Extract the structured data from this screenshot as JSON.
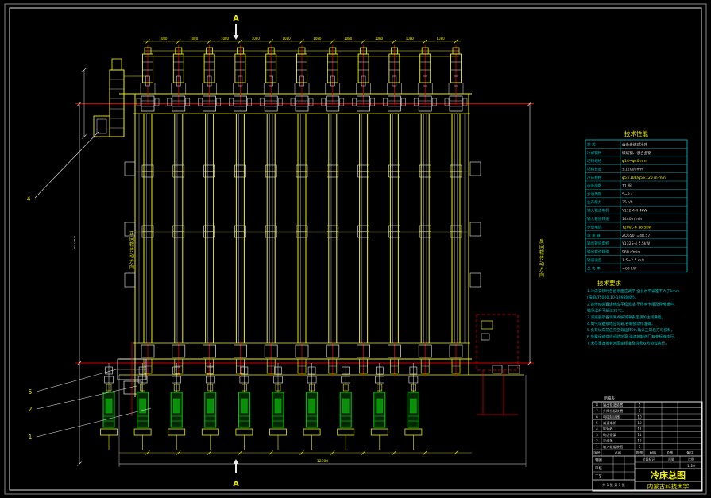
{
  "colors": {
    "yellow": "#f0f000",
    "red": "#d40000",
    "white": "#e8e8e8",
    "cyan": "#00b4b4",
    "green": "#00cc00",
    "dim_yellow": "#b8b800",
    "text_white": "#d8d8d8",
    "req_cyan": "#00c8c8"
  },
  "section_markers": {
    "top": "A",
    "bottom": "A"
  },
  "direction_labels": {
    "left": "正向辊传动方向",
    "right": "反向辊传动方向"
  },
  "callouts": [
    "4",
    "5",
    "2",
    "1"
  ],
  "dimensions": {
    "pitch": "1080",
    "total": "12300",
    "height": "4870"
  },
  "spec_table": {
    "title": "技术性能",
    "rows": [
      [
        "型 式",
        "齿条步进式冷床",
        0
      ],
      [
        "冷却钢种",
        "碳结钢、低合金钢",
        0
      ],
      [
        "坯料规格",
        "φ14~φ40mm",
        1
      ],
      [
        "坯料长度",
        "≤12000mm",
        0
      ],
      [
        "冷床规格",
        "φ5×108/φ5×120 m·min",
        1
      ],
      [
        "齿条组数",
        "11 组",
        0
      ],
      [
        "步进周期",
        "5~8 s",
        0
      ],
      [
        "生产能力",
        "25 t/h",
        0
      ],
      [
        "输入辊道电机",
        "Y112M-4  4kW",
        0
      ],
      [
        "输入辊道转速",
        "1440 r/min",
        0
      ],
      [
        "步进电机",
        "Y200L-6  18.5kW",
        1
      ],
      [
        "减 速 器",
        "ZQ650  i=48.57",
        0
      ],
      [
        "输出辊道电机",
        "Y132S-4  5.5kW",
        0
      ],
      [
        "输出辊道转速",
        "960 r/min",
        0
      ],
      [
        "辊道速度",
        "1.5~2.5 m/s",
        0
      ],
      [
        "总 功 率",
        "≈60 kW",
        0
      ]
    ]
  },
  "tech_requirements": {
    "title": "技术要求",
    "lines": [
      "1.冷床安装时各齿条面应调平,全长水平误差不大于1mm",
      "  (按JB/T5000.10-1998验收)。",
      "2.各传动装置运转应平稳灵活,不得有卡阻及异常噪声,",
      "  轴承温升不超过35℃。",
      "3.减速器及各润滑点按润滑表定期加注润滑脂。",
      "4.电气设备接地应可靠,各联锁动作准确。",
      "5.负荷试车前应先空载运转2h,确认正常后方可投料。",
      "6.外露运动件应设防护罩,油漆按制造厂有关标准执行。",
      "7.未尽事宜按有关国家标准及供需双方协议执行。"
    ]
  },
  "title_block": {
    "label_above": "明细表",
    "parts_header": [
      "序号",
      "名称",
      "数量",
      "材料",
      "单重",
      "备注"
    ],
    "parts": [
      [
        "8",
        "输出辊道装置",
        "1",
        ""
      ],
      [
        "7",
        "升降挡板装置",
        "1",
        ""
      ],
      [
        "6",
        "电磁制动器",
        "10",
        ""
      ],
      [
        "5",
        "减速电机",
        "10",
        ""
      ],
      [
        "4",
        "联轴器",
        "11",
        ""
      ],
      [
        "3",
        "动齿条梁",
        "11",
        ""
      ],
      [
        "2",
        "定齿条",
        "12",
        ""
      ],
      [
        "1",
        "输入辊道装置",
        "1",
        ""
      ]
    ],
    "sign_rows": [
      "制图",
      "审核",
      "工艺"
    ],
    "stage_label": "阶段标记",
    "mass_label": "质量",
    "scale_label": "比例",
    "scale_value": "1:20",
    "sheet_info": "共 1 张  第 1 张",
    "title": "冷床总图",
    "org": "内蒙古科技大学"
  }
}
